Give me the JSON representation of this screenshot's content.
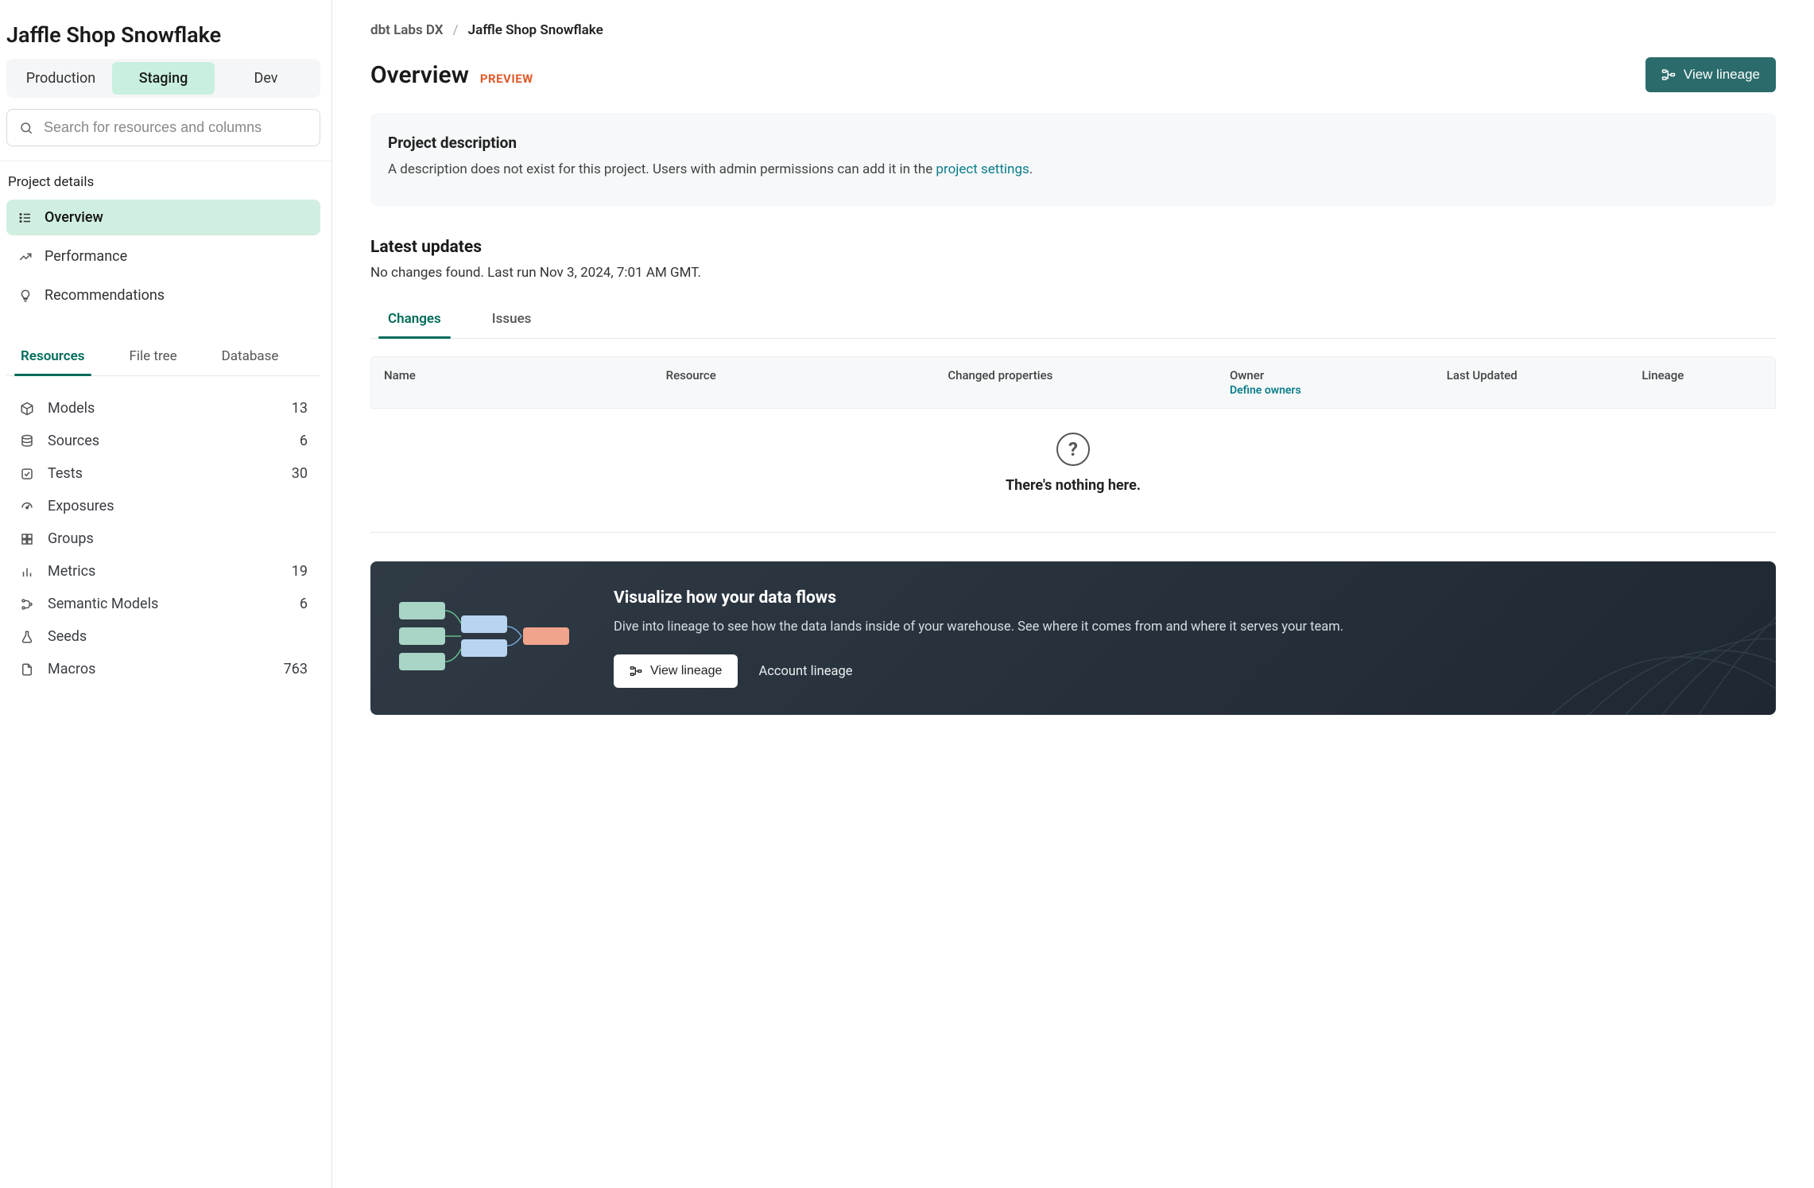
{
  "sidebar": {
    "title": "Jaffle Shop Snowflake",
    "env_tabs": [
      "Production",
      "Staging",
      "Dev"
    ],
    "env_active": 1,
    "search_placeholder": "Search for resources and columns",
    "section_label": "Project details",
    "nav": [
      {
        "label": "Overview"
      },
      {
        "label": "Performance"
      },
      {
        "label": "Recommendations"
      }
    ],
    "nav_active": 0,
    "sub_tabs": [
      "Resources",
      "File tree",
      "Database"
    ],
    "sub_active": 0,
    "resources": [
      {
        "label": "Models",
        "count": "13"
      },
      {
        "label": "Sources",
        "count": "6"
      },
      {
        "label": "Tests",
        "count": "30"
      },
      {
        "label": "Exposures",
        "count": ""
      },
      {
        "label": "Groups",
        "count": ""
      },
      {
        "label": "Metrics",
        "count": "19"
      },
      {
        "label": "Semantic Models",
        "count": "6"
      },
      {
        "label": "Seeds",
        "count": ""
      },
      {
        "label": "Macros",
        "count": "763"
      }
    ]
  },
  "breadcrumb": {
    "root": "dbt Labs DX",
    "current": "Jaffle Shop Snowflake"
  },
  "header": {
    "title": "Overview",
    "badge": "PREVIEW",
    "lineage_btn": "View lineage"
  },
  "description_card": {
    "title": "Project description",
    "text_prefix": "A description does not exist for this project. Users with admin permissions can add it in the ",
    "link_label": "project settings",
    "text_suffix": "."
  },
  "updates": {
    "title": "Latest updates",
    "subtext": "No changes found. Last run Nov 3, 2024, 7:01 AM GMT.",
    "tabs": [
      "Changes",
      "Issues"
    ],
    "tab_active": 0,
    "columns": {
      "name": "Name",
      "resource": "Resource",
      "changed": "Changed properties",
      "owner": "Owner",
      "owner_link": "Define owners",
      "last_updated": "Last Updated",
      "lineage": "Lineage"
    },
    "empty": "There's nothing here."
  },
  "promo": {
    "title": "Visualize how your data flows",
    "text": "Dive into lineage to see how the data lands inside of your warehouse. See where it comes from and where it serves your team.",
    "btn": "View lineage",
    "link": "Account lineage"
  }
}
